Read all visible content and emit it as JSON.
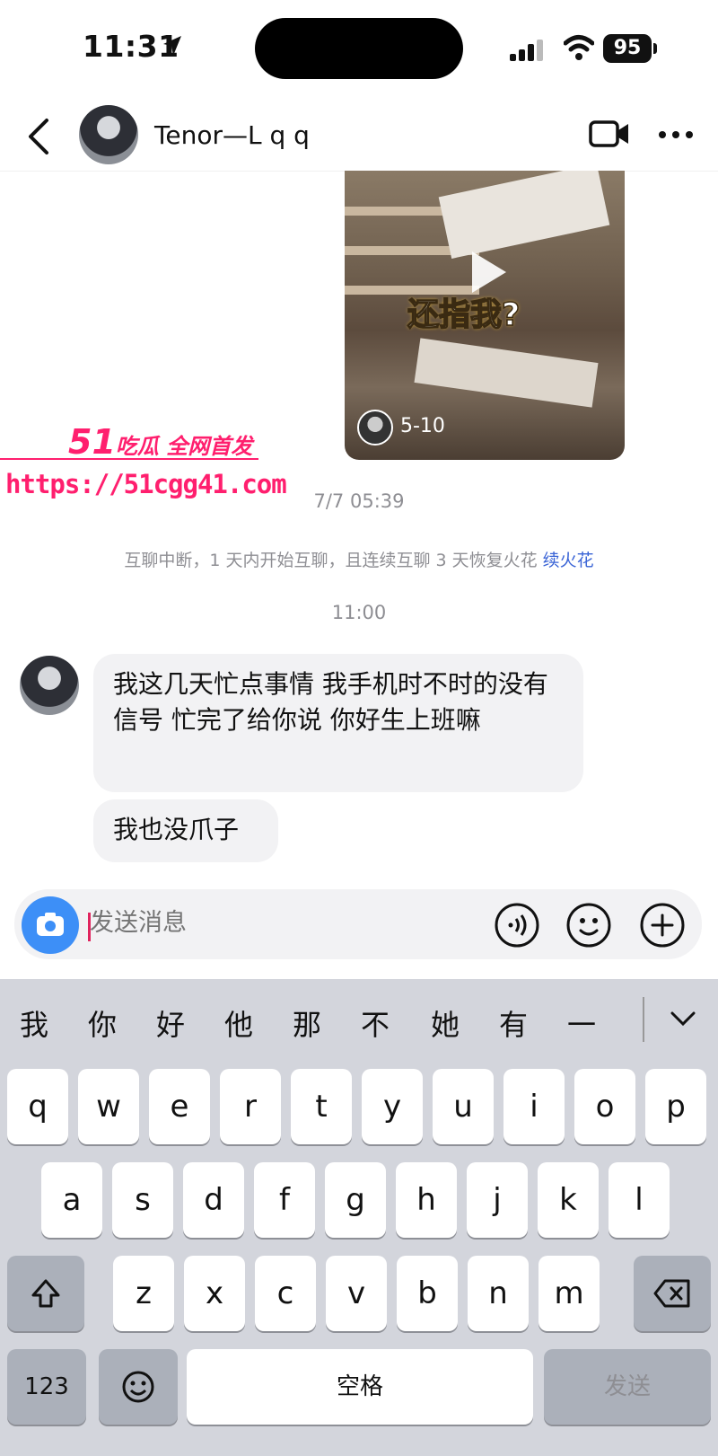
{
  "status_bar": {
    "time": "11:31",
    "battery": "95"
  },
  "header": {
    "contact_name": "Tenor—L q q"
  },
  "video_card": {
    "overlay_text": "还指我?",
    "date": "5-10"
  },
  "watermark": {
    "brand_number": "51",
    "brand_text": "吃瓜 全网首发",
    "url": "https://51cgg41.com"
  },
  "chat": {
    "timestamp_1": "7/7 05:39",
    "notice": "互聊中断，1 天内开始互聊，且连续互聊 3 天恢复火花",
    "notice_link": "续火花",
    "timestamp_2": "11:00",
    "messages": [
      {
        "text": "我这几天忙点事情 我手机时不时的没有信号 忙完了给你说 你好生上班嘛"
      },
      {
        "text": "我也没爪子"
      }
    ]
  },
  "input": {
    "placeholder": "发送消息"
  },
  "keyboard": {
    "candidates": [
      "我",
      "你",
      "好",
      "他",
      "那",
      "不",
      "她",
      "有",
      "一"
    ],
    "row1": [
      "q",
      "w",
      "e",
      "r",
      "t",
      "y",
      "u",
      "i",
      "o",
      "p"
    ],
    "row2": [
      "a",
      "s",
      "d",
      "f",
      "g",
      "h",
      "j",
      "k",
      "l"
    ],
    "row3": [
      "z",
      "x",
      "c",
      "v",
      "b",
      "n",
      "m"
    ],
    "numbers_label": "123",
    "space_label": "空格",
    "send_label": "发送"
  },
  "colors": {
    "accent_blue": "#3d8ff7",
    "watermark_pink": "#ff1f6e",
    "link_blue": "#3a64d6"
  },
  "icons": [
    "location-arrow-icon",
    "signal-icon",
    "wifi-icon",
    "back-icon",
    "video-call-icon",
    "more-icon",
    "play-icon",
    "camera-icon",
    "voice-icon",
    "emoji-icon",
    "plus-icon",
    "chevron-down-icon",
    "shift-icon",
    "backspace-icon",
    "keyboard-emoji-icon"
  ]
}
